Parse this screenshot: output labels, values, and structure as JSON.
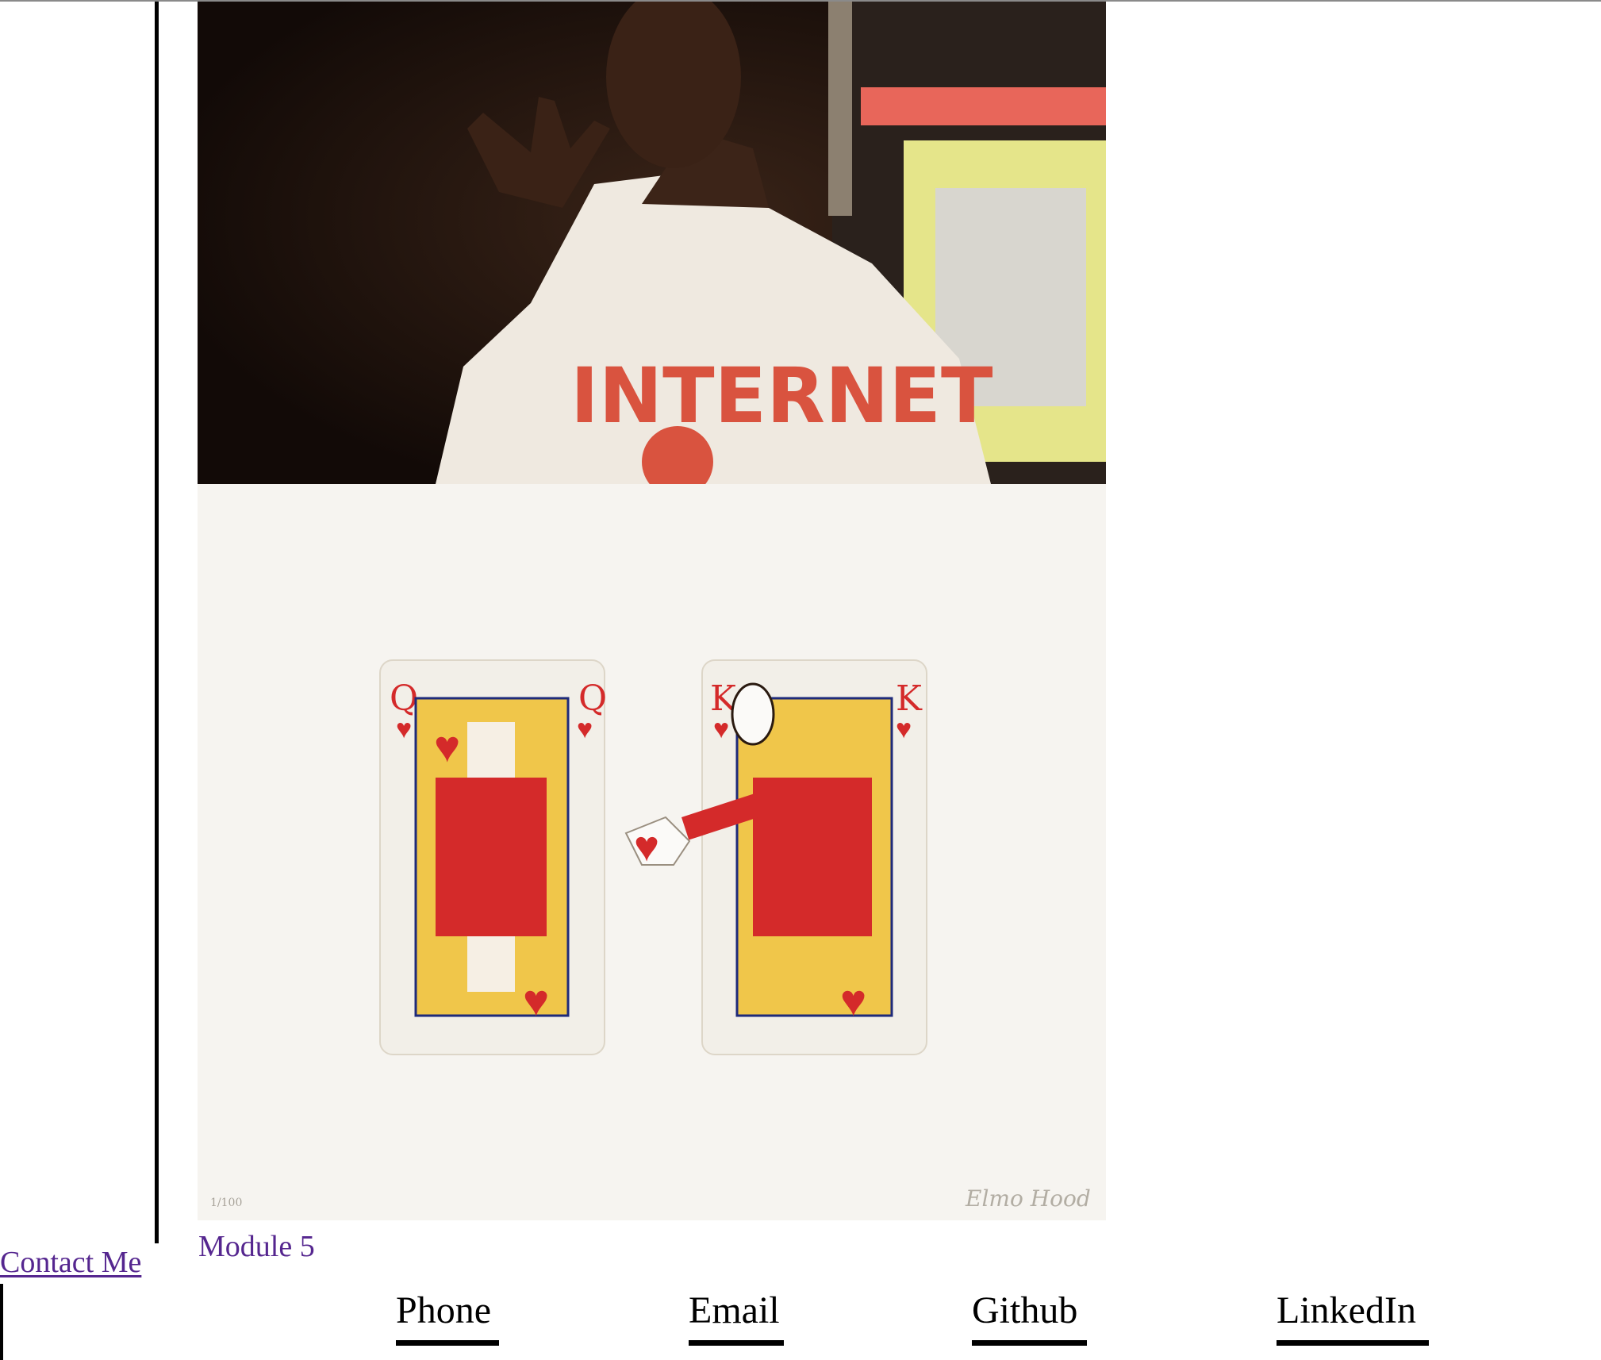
{
  "images": [
    {
      "name": "portrait-photo",
      "shirt_text": "INTERNET"
    },
    {
      "name": "playing-cards-artwork",
      "edition": "1/100",
      "signature": "Elmo Hood",
      "cards": [
        {
          "rank": "Q",
          "suit": "heart-icon",
          "color": "#d42a2a"
        },
        {
          "rank": "K",
          "suit": "heart-icon",
          "color": "#d42a2a"
        }
      ]
    }
  ],
  "nav": {
    "module_link": "Module 5",
    "contact_link": "Contact Me"
  },
  "contacts": [
    {
      "label": "Phone"
    },
    {
      "label": "Email"
    },
    {
      "label": "Github"
    },
    {
      "label": "LinkedIn"
    }
  ],
  "colors": {
    "link": "#55268f",
    "text": "#000000",
    "card_red": "#d42a2a"
  }
}
